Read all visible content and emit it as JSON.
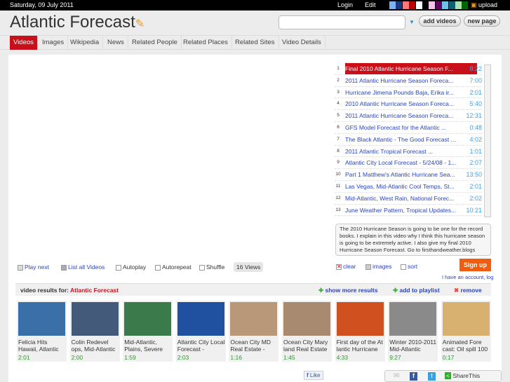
{
  "topbar": {
    "date": "Saturday, 09 July 2011",
    "login": "Login",
    "edit": "Edit",
    "upload": "upload",
    "swatches": [
      "#7fb2f0",
      "#1a3a7a",
      "#f77",
      "#b00",
      "#fff",
      "#000",
      "#f9c0f0",
      "#660066",
      "#6cc4e8",
      "#0f6070",
      "#aee0b0",
      "#006600"
    ]
  },
  "header": {
    "title": "Atlantic Forecast",
    "add_videos": "add videos",
    "new_page": "new page",
    "search_value": ""
  },
  "tabs": [
    "Videos",
    "Images",
    "Wikipedia",
    "News",
    "Related People",
    "Related Places",
    "Related Sites",
    "Video Details"
  ],
  "playlist": [
    {
      "n": "1",
      "title": "Final 2010 Atlantic Hurricane Season F...",
      "dur": "8:22"
    },
    {
      "n": "2",
      "title": "2011 Atlantic Hurricane Season Foreca...",
      "dur": "7:00"
    },
    {
      "n": "3",
      "title": "Hurricane Jimena Pounds Baja, Erika ir...",
      "dur": "2:01"
    },
    {
      "n": "4",
      "title": "2010 Atlantic Hurricane Season Foreca...",
      "dur": "5:40"
    },
    {
      "n": "5",
      "title": "2011 Atlantic Hurricane Season Foreca...",
      "dur": "12:31"
    },
    {
      "n": "6",
      "title": "GFS Model Forecast for the Atlantic       ...",
      "dur": "0:48"
    },
    {
      "n": "7",
      "title": "The Black Atlantic - The Good Forecast ...",
      "dur": "4:02"
    },
    {
      "n": "8",
      "title": "2011 Atlantic Tropical Forecast              ...",
      "dur": "1:01"
    },
    {
      "n": "9",
      "title": "Atlantic City Local Forecast - 5/24/08 - 1...",
      "dur": "2:07"
    },
    {
      "n": "10",
      "title": "Part 1 Matthew's Atlantic Hurricane Sea...",
      "dur": "13:50"
    },
    {
      "n": "11",
      "title": "Las Vegas, Mid-Atlantic Cool Temps, St...",
      "dur": "2:01"
    },
    {
      "n": "12",
      "title": "Mid-Atlantic, West Rain, National Forec...",
      "dur": "2:02"
    },
    {
      "n": "13",
      "title": "June Weather Pattern, Tropical Updates...",
      "dur": "10:21"
    }
  ],
  "description": "The 2010 Hurricane Season is going to be one for the record books. I explain in this video why I think this hurricane season is going to be extremely active. I also give my final 2010 Hurricane Season Forecast. Go to firsthandweather.blogs",
  "controls": {
    "play_next": "Play next",
    "list_all": "List all Videos",
    "autoplay": "Autoplay",
    "autorepeat": "Autorepeat",
    "shuffle": "Shuffle",
    "views": "16 Views",
    "clear": "clear",
    "images": "images",
    "sort": "sort",
    "signup": "Sign up",
    "account": "I have an account, log"
  },
  "results": {
    "label": "video results for:",
    "query": "Atlantic Forecast",
    "show_more": "show more results",
    "add_playlist": "add to playlist",
    "remove": "remove"
  },
  "thumbs": [
    {
      "cap": "Felicia Hits Hawaii, Atlantic",
      "dur": "2:01",
      "color": "#3a6fa8"
    },
    {
      "cap": "Colin Redevel ops, Mid-Atlantic",
      "dur": "2:00",
      "color": "#445a7a"
    },
    {
      "cap": "Mid-Atlantic, Plains, Severe",
      "dur": "1:59",
      "color": "#3b7a4a"
    },
    {
      "cap": "Atlantic City Local Forecast -",
      "dur": "2:03",
      "color": "#2050a0"
    },
    {
      "cap": "Ocean City MD Real Estate -",
      "dur": "1:16",
      "color": "#b89878"
    },
    {
      "cap": "Ocean City Mary land Real Estate",
      "dur": "1:45",
      "color": "#a88a70"
    },
    {
      "cap": "First day of the At lantic Hurricane",
      "dur": "4:33",
      "color": "#d05020"
    },
    {
      "cap": "Winter 2010-2011 Mid-Atlantic",
      "dur": "9:27",
      "color": "#8a8a8a"
    },
    {
      "cap": "Animated Fore cast: Oil spill 100",
      "dur": "0:17",
      "color": "#d8b070"
    }
  ],
  "footer": {
    "like": "Like",
    "share": "ShareThis"
  }
}
